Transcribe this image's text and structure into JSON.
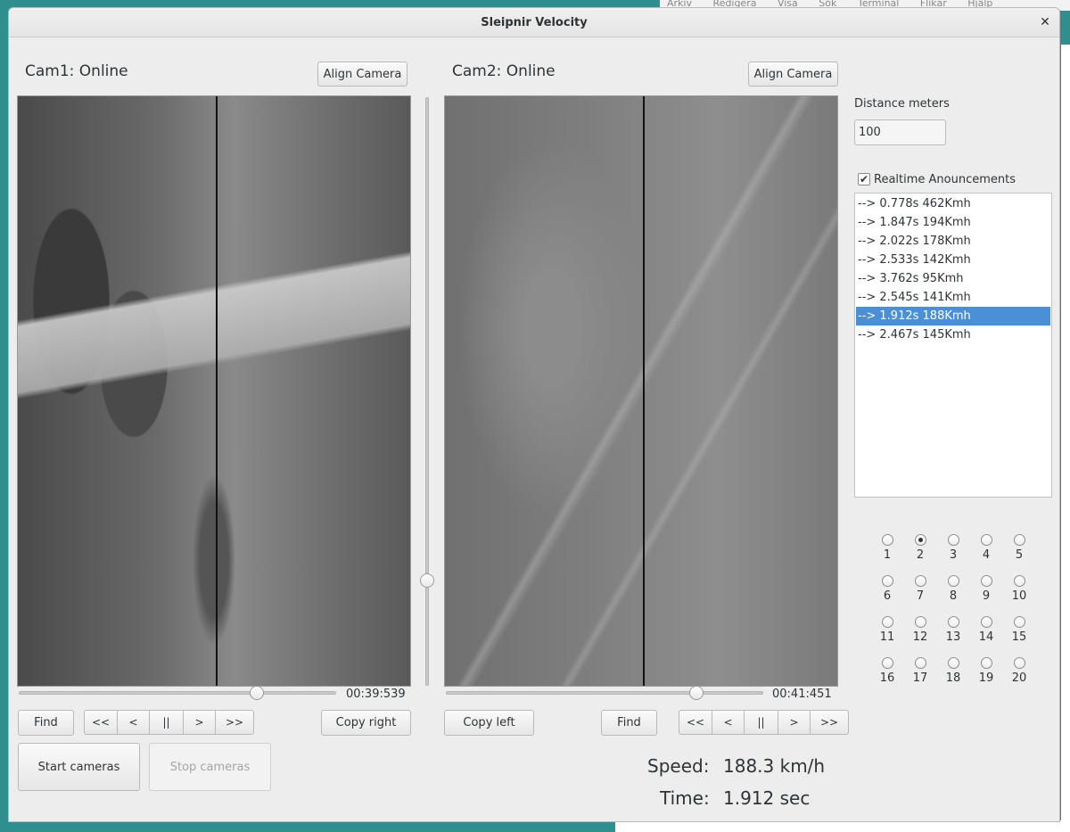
{
  "background": {
    "menubar_items": [
      "Arkiv",
      "Redigera",
      "Visa",
      "Sök",
      "Terminal",
      "Flikar",
      "Hjälp"
    ]
  },
  "window": {
    "title": "Sleipnir Velocity",
    "close_glyph": "✕"
  },
  "cam1": {
    "status": "Cam1: Online",
    "align_label": "Align Camera",
    "time": "00:39:539",
    "find_label": "Find",
    "copy_label": "Copy right",
    "slider_fraction": 0.75
  },
  "cam2": {
    "status": "Cam2: Online",
    "align_label": "Align Camera",
    "time": "00:41:451",
    "find_label": "Find",
    "copy_label": "Copy left",
    "slider_fraction": 0.79
  },
  "playback": {
    "rewind_fast": "<<",
    "rewind": "<",
    "pause": "||",
    "forward": ">",
    "forward_fast": ">>"
  },
  "controls": {
    "start_label": "Start cameras",
    "stop_label": "Stop cameras"
  },
  "sidebar": {
    "distance_label": "Distance meters",
    "distance_value": "100",
    "checkbox_glyph": "✔",
    "realtime_label": "Realtime Anouncements",
    "announcements": [
      "--> 0.778s 462Kmh",
      "--> 1.847s 194Kmh",
      "--> 2.022s 178Kmh",
      "--> 2.533s 142Kmh",
      "--> 3.762s 95Kmh",
      "--> 2.545s 141Kmh",
      "--> 1.912s 188Kmh",
      "--> 2.467s 145Kmh"
    ],
    "selected_index": 6,
    "radios": [
      "1",
      "2",
      "3",
      "4",
      "5",
      "6",
      "7",
      "8",
      "9",
      "10",
      "11",
      "12",
      "13",
      "14",
      "15",
      "16",
      "17",
      "18",
      "19",
      "20"
    ],
    "radio_checked": "2"
  },
  "results": {
    "speed_label": "Speed:",
    "speed_value": "188.3 km/h",
    "time_label": "Time:",
    "time_value": "1.912 sec"
  }
}
